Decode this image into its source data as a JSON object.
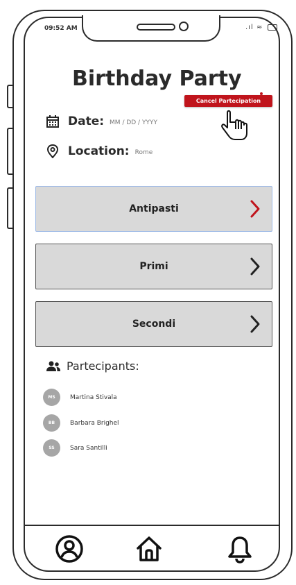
{
  "status_bar": {
    "time": "09:52 AM"
  },
  "event": {
    "title": "Birthday Party",
    "date_label": "Date:",
    "date_value": "MM / DD / YYYY",
    "location_label": "Location:",
    "location_value": "Rome"
  },
  "menu": {
    "cancel_label": "Cancel Partecipation"
  },
  "courses": [
    {
      "label": "Antipasti",
      "chevron_color": "#c0141c"
    },
    {
      "label": "Primi",
      "chevron_color": "#222222"
    },
    {
      "label": "Secondi",
      "chevron_color": "#222222"
    }
  ],
  "participants": {
    "heading": "Partecipants:",
    "list": [
      {
        "initials": "MS",
        "name": "Martina Stivala"
      },
      {
        "initials": "BB",
        "name": "Barbara Brighel"
      },
      {
        "initials": "SS",
        "name": "Sara Santilli"
      }
    ]
  },
  "bottom_nav": {
    "items": [
      "profile-icon",
      "home-icon",
      "bell-icon"
    ]
  },
  "colors": {
    "accent": "#c0141c",
    "course_bg": "#d9d9d9",
    "avatar_bg": "#a6a6a6"
  }
}
